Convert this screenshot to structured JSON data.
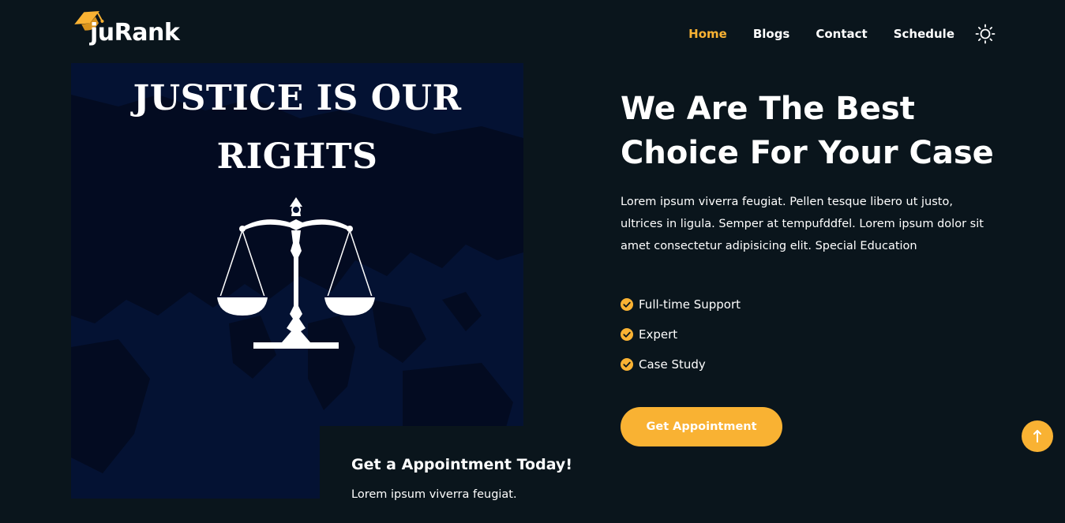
{
  "brand": {
    "name": "juRank",
    "icon": "graduation-cap-icon",
    "accent": "#f9b233"
  },
  "nav": {
    "items": [
      {
        "label": "Home",
        "active": true
      },
      {
        "label": "Blogs",
        "active": false
      },
      {
        "label": "Contact",
        "active": false
      },
      {
        "label": "Schedule",
        "active": false
      }
    ],
    "theme_icon": "sun-icon"
  },
  "hero_image": {
    "title_line1": "JUSTICE IS OUR",
    "title_line2": "RIGHTS",
    "icon": "scales-of-justice-icon"
  },
  "appointment_card": {
    "title": "Get a Appointment Today!",
    "text": "Lorem ipsum viverra feugiat."
  },
  "main": {
    "headline_line1": "We Are The Best",
    "headline_line2": "Choice For Your Case",
    "description": "Lorem ipsum viverra feugiat. Pellen tesque libero ut justo, ultrices in ligula. Semper at tempufddfel. Lorem ipsum dolor sit amet consectetur adipisicing elit. Special Education",
    "features": [
      "Full-time Support",
      "Expert",
      "Case Study"
    ],
    "cta_label": "Get Appointment"
  },
  "back_to_top": {
    "icon": "arrow-up-icon"
  }
}
